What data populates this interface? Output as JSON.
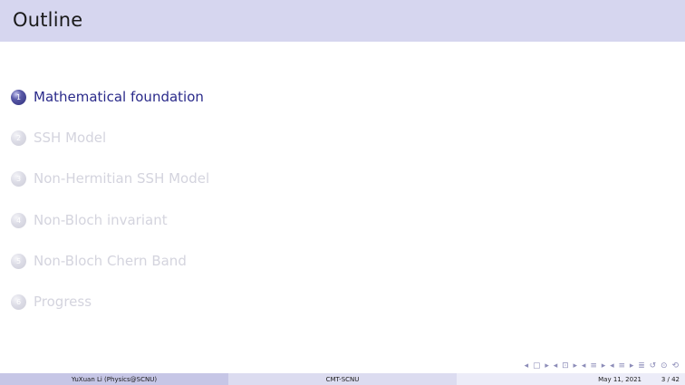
{
  "slide": {
    "title": "Outline"
  },
  "outline": {
    "items": [
      {
        "number": "1",
        "label": "Mathematical foundation",
        "active": true
      },
      {
        "number": "2",
        "label": "SSH Model",
        "active": false
      },
      {
        "number": "3",
        "label": "Non-Hermitian SSH Model",
        "active": false
      },
      {
        "number": "4",
        "label": "Non-Bloch invariant",
        "active": false
      },
      {
        "number": "5",
        "label": "Non-Bloch Chern Band",
        "active": false
      },
      {
        "number": "6",
        "label": "Progress",
        "active": false
      }
    ]
  },
  "navigation": {
    "symbols": "◂ ▢ ▸ ◂ ⊡ ▸ ◂ ≡ ▸ ◂ ≡ ▸ ≣ ↺ ⊙ ⟲"
  },
  "footer": {
    "author": "YuXuan Li (Physics@SCNU)",
    "institute": "CMT-SCNU",
    "date": "May 11, 2021",
    "page": "3 / 42"
  },
  "colors": {
    "title_bar": "#d6d6ef",
    "active_text": "#2a2a8a",
    "dim_text": "#d4d4de",
    "footer_left": "#c6c6e6",
    "footer_mid": "#dcdcf0",
    "footer_right": "#ececf8"
  }
}
